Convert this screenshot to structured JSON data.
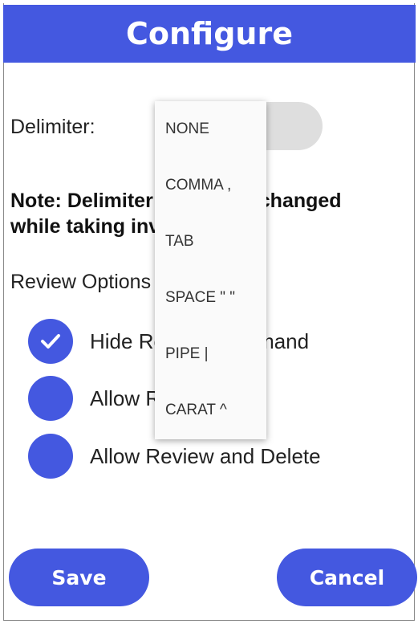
{
  "header": {
    "title": "Configure"
  },
  "delimiter": {
    "label": "Delimiter:"
  },
  "note": {
    "text": "Note: Delimiter cannot be changed while taking inventory"
  },
  "review": {
    "heading": "Review Options",
    "options": [
      {
        "label": "Hide Review Command",
        "checked": true
      },
      {
        "label": "Allow Review Only",
        "checked": false
      },
      {
        "label": "Allow Review and Delete",
        "checked": false
      }
    ]
  },
  "dropdown": {
    "items": [
      "NONE",
      "COMMA ,",
      "TAB",
      "SPACE \" \"",
      "PIPE |",
      "CARAT ^"
    ]
  },
  "actions": {
    "save_label": "Save",
    "cancel_label": "Cancel"
  },
  "colors": {
    "accent": "#4458e0",
    "switch_track": "#dedede"
  }
}
